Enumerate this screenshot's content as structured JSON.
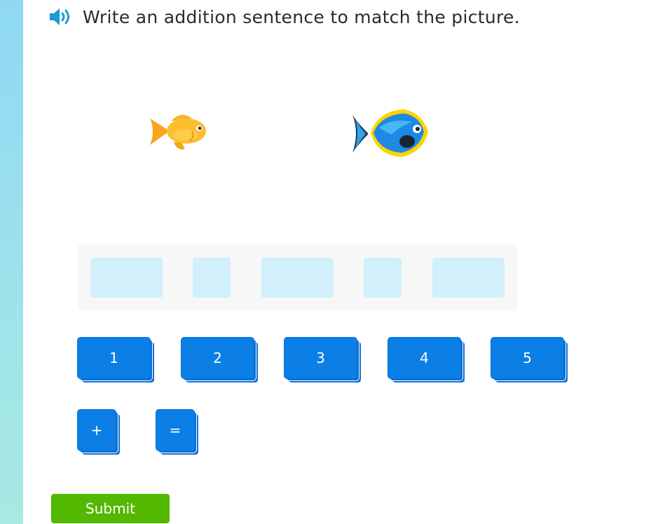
{
  "question": {
    "text": "Write an addition sentence to match the picture.",
    "audio_icon": "speaker-icon"
  },
  "picture": {
    "items": [
      {
        "icon": "goldfish-icon",
        "color": "#f9b233"
      },
      {
        "icon": "blue-tang-fish-icon",
        "color": "#1e88e5"
      }
    ]
  },
  "answer_slots": [
    {
      "value": ""
    },
    {
      "value": ""
    },
    {
      "value": ""
    },
    {
      "value": ""
    },
    {
      "value": ""
    }
  ],
  "number_tiles": [
    "1",
    "2",
    "3",
    "4",
    "5"
  ],
  "symbol_tiles": [
    "+",
    "="
  ],
  "submit": {
    "label": "Submit"
  },
  "colors": {
    "tile_blue": "#0b7fe6",
    "slot_blue": "#d1f0fb",
    "submit_green": "#52b800",
    "speaker_blue": "#1a9ad6"
  }
}
